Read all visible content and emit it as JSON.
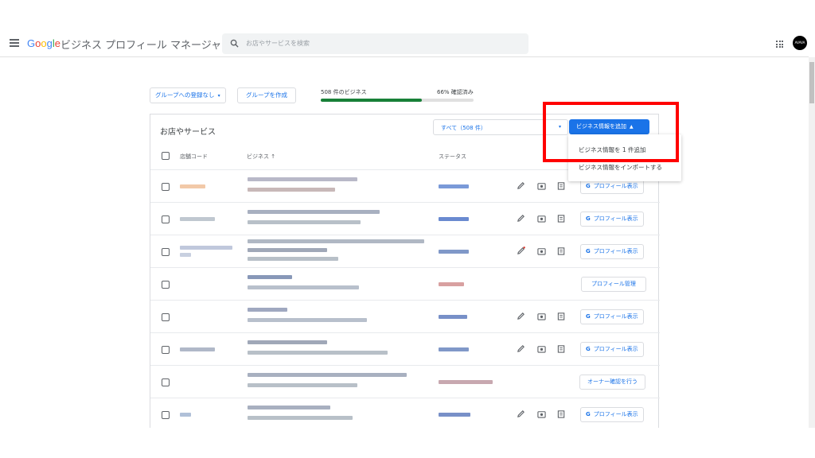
{
  "header": {
    "logo": [
      "G",
      "o",
      "o",
      "g",
      "l",
      "e"
    ],
    "app_name": "ビジネス プロフィール マネージャ",
    "search_placeholder": "お店やサービスを検索",
    "avatar_text": "AVAVA"
  },
  "toolbar": {
    "group_button": "グループへの登録なし",
    "create_group_button": "グループを作成",
    "business_count_label": "508 件のビジネス",
    "verified_label": "66% 確認済み",
    "verified_fraction": 0.66
  },
  "card": {
    "title": "お店やサービス",
    "filter_label": "すべて（508 件）",
    "add_button": "ビジネス情報を追加"
  },
  "menu": {
    "items": [
      "ビジネス情報を 1 件追加",
      "ビジネス情報をインポートする"
    ]
  },
  "table": {
    "columns": [
      "店舗コード",
      "ビジネス ↑",
      "ステータス"
    ],
    "rows": [
      {
        "action": "プロフィール表示"
      },
      {
        "action": "プロフィール表示"
      },
      {
        "action": "プロフィール表示"
      },
      {
        "action": "プロフィール管理"
      },
      {
        "action": "プロフィール表示"
      },
      {
        "action": "プロフィール表示"
      },
      {
        "action": "オーナー確認を行う"
      },
      {
        "action": "プロフィール表示"
      }
    ]
  },
  "colors": {
    "accent": "#1a73e8",
    "progress": "#188038",
    "highlight": "#ff0000"
  }
}
